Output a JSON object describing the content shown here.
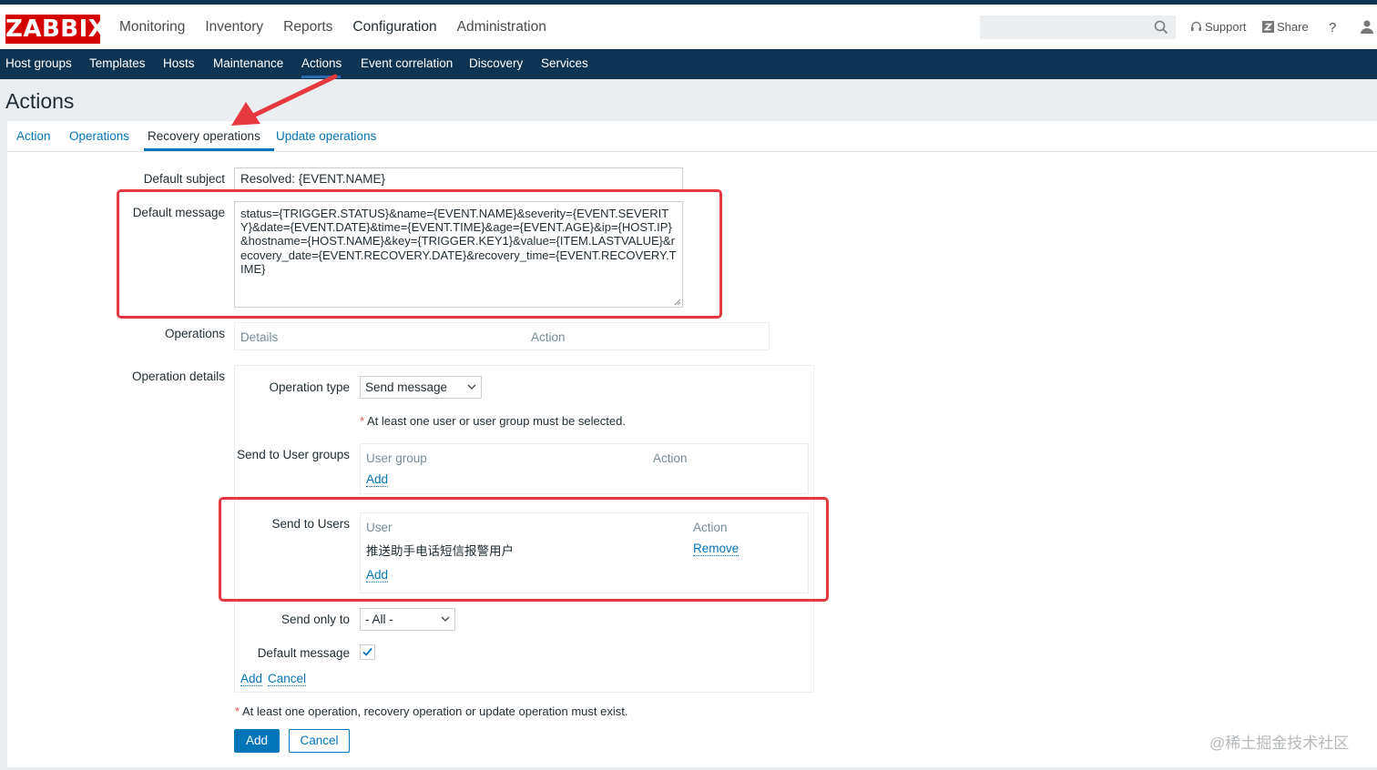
{
  "header": {
    "logo": "ZABBIX",
    "menu": [
      "Monitoring",
      "Inventory",
      "Reports",
      "Configuration",
      "Administration"
    ],
    "active_menu": "Configuration",
    "search_placeholder": "",
    "support": "Support",
    "share": "Share",
    "help": "?"
  },
  "submenu": {
    "items": [
      "Host groups",
      "Templates",
      "Hosts",
      "Maintenance",
      "Actions",
      "Event correlation",
      "Discovery",
      "Services"
    ],
    "active": "Actions"
  },
  "page": {
    "title": "Actions"
  },
  "tabs": {
    "items": [
      "Action",
      "Operations",
      "Recovery operations",
      "Update operations"
    ],
    "active": "Recovery operations"
  },
  "form": {
    "default_subject_label": "Default subject",
    "default_subject_value": "Resolved: {EVENT.NAME}",
    "default_message_label": "Default message",
    "default_message_value": "status={TRIGGER.STATUS}&name={EVENT.NAME}&severity={EVENT.SEVERITY}&date={EVENT.DATE}&time={EVENT.TIME}&age={EVENT.AGE}&ip={HOST.IP}&hostname={HOST.NAME}&key={TRIGGER.KEY1}&value={ITEM.LASTVALUE}&recovery_date={EVENT.RECOVERY.DATE}&recovery_time={EVENT.RECOVERY.TIME}",
    "operations_label": "Operations",
    "operations_col_details": "Details",
    "operations_col_action": "Action",
    "operation_details_label": "Operation details",
    "operation_type_label": "Operation type",
    "operation_type_value": "Send message",
    "required_user_note": "At least one user or user group must be selected.",
    "send_user_groups_label": "Send to User groups",
    "user_group_col": "User group",
    "user_group_action_col": "Action",
    "add_link": "Add",
    "send_users_label": "Send to Users",
    "user_col": "User",
    "user_action_col": "Action",
    "users": [
      {
        "name": "推送助手电话短信报警用户",
        "action": "Remove"
      }
    ],
    "send_only_to_label": "Send only to",
    "send_only_to_value": "- All -",
    "default_message_checkbox_label": "Default message",
    "default_message_checked": true,
    "details_add": "Add",
    "details_cancel": "Cancel",
    "required_operation_note": "At least one operation, recovery operation or update operation must exist.",
    "add_button": "Add",
    "cancel_button": "Cancel"
  },
  "watermark": "@稀土掘金技术社区",
  "colors": {
    "brand": "#d40000",
    "nav_bg": "#0e3453",
    "link": "#0275b8",
    "highlight": "#e6393f"
  }
}
